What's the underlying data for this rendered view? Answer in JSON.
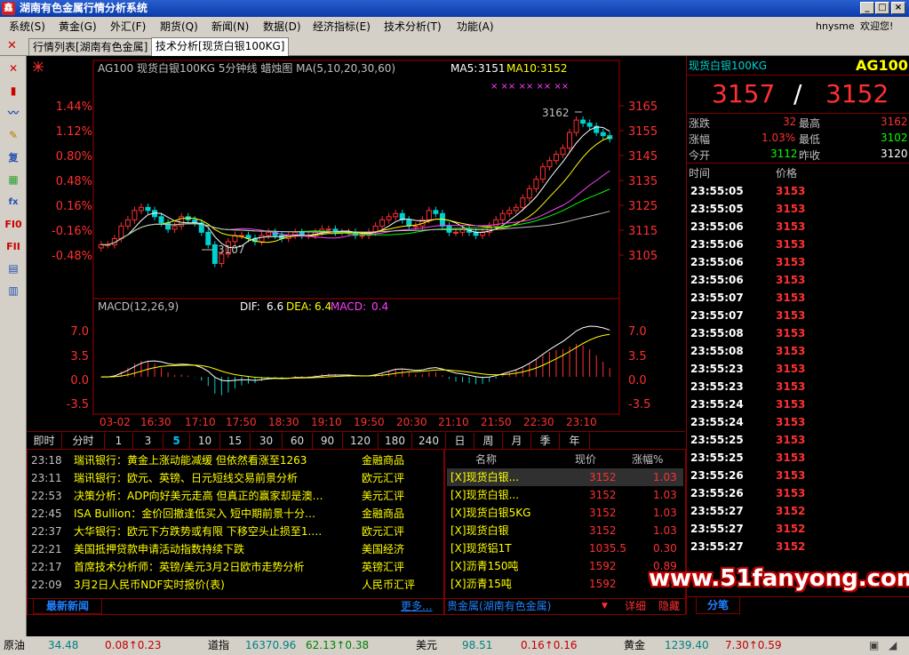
{
  "window": {
    "title": "湖南有色金属行情分析系统",
    "logo": "鑫",
    "minimize": "_",
    "maximize": "□",
    "close": "×"
  },
  "menu": {
    "items": [
      "系统(S)",
      "黄金(G)",
      "外汇(F)",
      "期货(Q)",
      "新闻(N)",
      "数据(D)",
      "经济指标(E)",
      "技术分析(T)",
      "功能(A)"
    ],
    "user": "hnysme",
    "welcome": "欢迎您!"
  },
  "tabs": [
    {
      "label": "行情列表[湖南有色金属]"
    },
    {
      "label": "技术分析[现货白银100KG]"
    }
  ],
  "toolbar": {
    "icons": [
      "close-icon",
      "candlestick-icon",
      "line-chart-icon",
      "edit-icon",
      "copy-icon",
      "grid-icon",
      "formula-icon",
      "f10-icon",
      "f11-icon",
      "list-icon",
      "report-icon"
    ],
    "labels": [
      "✕",
      "▮",
      "〰",
      "✎",
      "复",
      "▦",
      "fx",
      "FI0",
      "FII",
      "▤",
      "▥"
    ]
  },
  "chart": {
    "header": "AG100 现货白银100KG 5分钟线 蜡烛图 MA(5,10,20,30,60)",
    "ma5_label": "MA5:",
    "ma5_value": "3151",
    "ma10_label": "MA10:",
    "ma10_value": "3152",
    "markers": "× ××   ××  ××     ××",
    "left_axis": [
      "1.44%",
      "1.12%",
      "0.80%",
      "0.48%",
      "0.16%",
      "-0.16%",
      "-0.48%"
    ],
    "right_axis": [
      "3165",
      "3155",
      "3145",
      "3135",
      "3125",
      "3115",
      "3105"
    ],
    "high_label": "3162",
    "low_label": "3107",
    "macd_header": "MACD(12,26,9)",
    "dif_label": "DIF:",
    "dif_value": "6.6",
    "dea_label": "DEA:",
    "dea_value": "6.4",
    "macd_label": "MACD:",
    "macd_value": "0.4",
    "macd_axis": [
      "7.0",
      "3.5",
      "0.0",
      "-3.5"
    ],
    "time_axis": [
      "03-02",
      "16:30",
      "17:10",
      "17:50",
      "18:30",
      "19:10",
      "19:50",
      "20:30",
      "21:10",
      "21:50",
      "22:30",
      "23:10"
    ]
  },
  "chart_data": {
    "type": "candlestick",
    "title": "AG100 现货白银100KG 5分钟线",
    "ylim": [
      3103,
      3170
    ],
    "close": [
      3118,
      3118,
      3120,
      3124,
      3126,
      3129,
      3130,
      3129,
      3127,
      3125,
      3123,
      3124,
      3127,
      3126,
      3125,
      3122,
      3118,
      3112,
      3115,
      3119,
      3121,
      3121,
      3120,
      3119,
      3121,
      3122,
      3121,
      3120,
      3121,
      3122,
      3121,
      3121,
      3122,
      3123,
      3123,
      3122,
      3122,
      3122,
      3121,
      3121,
      3122,
      3124,
      3126,
      3127,
      3128,
      3126,
      3124,
      3124,
      3126,
      3129,
      3128,
      3124,
      3122,
      3122,
      3123,
      3122,
      3121,
      3122,
      3124,
      3126,
      3128,
      3129,
      3130,
      3133,
      3136,
      3139,
      3143,
      3145,
      3147,
      3149,
      3154,
      3158,
      3157,
      3156,
      3154,
      3153,
      3152
    ]
  },
  "periods": [
    "即时",
    "分时",
    "1",
    "3",
    "5",
    "10",
    "15",
    "30",
    "60",
    "90",
    "120",
    "180",
    "240",
    "日",
    "周",
    "月",
    "季",
    "年"
  ],
  "news": {
    "rows": [
      {
        "time": "23:18",
        "title": "瑞讯银行：黄金上涨动能减缓 但依然看涨至1263",
        "cat": "金融商品"
      },
      {
        "time": "23:11",
        "title": "瑞讯银行：欧元、英镑、日元短线交易前景分析",
        "cat": "欧元汇评"
      },
      {
        "time": "22:53",
        "title": "决策分析：ADP向好美元走高  但真正的赢家却是澳…",
        "cat": "美元汇评"
      },
      {
        "time": "22:45",
        "title": "ISA Bullion：金价回撤逢低买入  短中期前景十分…",
        "cat": "金融商品"
      },
      {
        "time": "22:37",
        "title": "大华银行：欧元下方跌势或有限  下移空头止损至1.…",
        "cat": "欧元汇评"
      },
      {
        "time": "22:21",
        "title": "美国抵押贷款申请活动指数持续下跌",
        "cat": "美国经济"
      },
      {
        "time": "22:17",
        "title": "首席技术分析师：英镑/美元3月2日欧市走势分析",
        "cat": "英镑汇评"
      },
      {
        "time": "22:09",
        "title": "3月2日人民币NDF实时报价(表)",
        "cat": "人民币汇评"
      }
    ],
    "footer_label": "最新新闻",
    "more_label": "更多..."
  },
  "quotes": {
    "headers": [
      "名称",
      "现价",
      "涨幅%"
    ],
    "rows": [
      {
        "name": "[X]现货白银...",
        "price": "3152",
        "change": "1.03"
      },
      {
        "name": "[X]现货白银...",
        "price": "3152",
        "change": "1.03"
      },
      {
        "name": "[X]现货白银5KG",
        "price": "3152",
        "change": "1.03"
      },
      {
        "name": "[X]现货白银",
        "price": "3152",
        "change": "1.03"
      },
      {
        "name": "[X]现货铝1T",
        "price": "1035.5",
        "change": "0.30"
      },
      {
        "name": "[X]沥青150吨",
        "price": "1592",
        "change": "0.89"
      },
      {
        "name": "[X]沥青15吨",
        "price": "1592",
        "change": "0.89"
      }
    ],
    "footer_label": "贵金属(湖南有色金属)",
    "detail_label": "详细",
    "hide_label": "隐藏"
  },
  "right": {
    "name": "现货白银100KG",
    "code": "AG100",
    "bid": "3157",
    "sep": "/",
    "ask": "3152",
    "zd_label": "涨跌",
    "zd_value": "32",
    "high_label": "最高",
    "high_value": "3162",
    "zf_label": "涨幅",
    "zf_value": "1.03%",
    "low_label": "最低",
    "low_value": "3102",
    "open_label": "今开",
    "open_value": "3112",
    "prev_label": "昨收",
    "prev_value": "3120",
    "time_header": "时间",
    "price_header": "价格",
    "ticks": [
      {
        "t": "23:55:05",
        "p": "3153"
      },
      {
        "t": "23:55:05",
        "p": "3153"
      },
      {
        "t": "23:55:06",
        "p": "3153"
      },
      {
        "t": "23:55:06",
        "p": "3153"
      },
      {
        "t": "23:55:06",
        "p": "3153"
      },
      {
        "t": "23:55:06",
        "p": "3153"
      },
      {
        "t": "23:55:07",
        "p": "3153"
      },
      {
        "t": "23:55:07",
        "p": "3153"
      },
      {
        "t": "23:55:08",
        "p": "3153"
      },
      {
        "t": "23:55:08",
        "p": "3153"
      },
      {
        "t": "23:55:23",
        "p": "3153"
      },
      {
        "t": "23:55:23",
        "p": "3153"
      },
      {
        "t": "23:55:24",
        "p": "3153"
      },
      {
        "t": "23:55:24",
        "p": "3153"
      },
      {
        "t": "23:55:25",
        "p": "3153"
      },
      {
        "t": "23:55:25",
        "p": "3153"
      },
      {
        "t": "23:55:26",
        "p": "3153"
      },
      {
        "t": "23:55:26",
        "p": "3153"
      },
      {
        "t": "23:55:27",
        "p": "3152"
      },
      {
        "t": "23:55:27",
        "p": "3152"
      },
      {
        "t": "23:55:27",
        "p": "3152"
      }
    ],
    "tab_label": "分笔"
  },
  "status": {
    "items": [
      {
        "name": "原油",
        "value": "34.48",
        "change": "0.08↑0.23"
      },
      {
        "name": "道指",
        "value": "16370.96",
        "change": "62.13↑0.38"
      },
      {
        "name": "美元",
        "value": "98.51",
        "change": "0.16↑0.16"
      },
      {
        "name": "黄金",
        "value": "1239.40",
        "change": "7.30↑0.59"
      }
    ]
  },
  "watermark": "www.51fanyong.com",
  "colors": {
    "up": "#ff3030",
    "down": "#00d0d0",
    "axis_red": "#ff3030",
    "grid": "#800000",
    "yellow": "#ffff00",
    "green": "#00ff00"
  }
}
